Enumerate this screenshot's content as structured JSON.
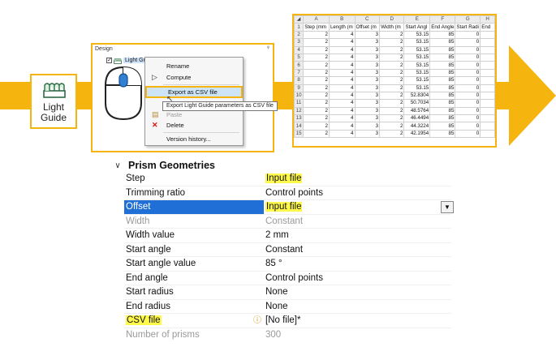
{
  "flow": {
    "accent": "#f6b40e"
  },
  "light_guide_tile": {
    "icon": "light-guide-icon",
    "label_line1": "Light",
    "label_line2": "Guide"
  },
  "design_panel": {
    "title": "Design",
    "tree_item": "Light Guide 1",
    "context_menu": [
      {
        "label": "Rename",
        "icon": ""
      },
      {
        "label": "Compute",
        "icon": "play-icon"
      },
      {
        "label": "Export as CSV file",
        "icon": ""
      },
      {
        "label": "Paste",
        "icon": "paste-icon"
      },
      {
        "label": "Delete",
        "icon": "delete-icon"
      },
      {
        "label": "Version history...",
        "icon": ""
      }
    ],
    "tooltip": "Export Light Guide parameters as CSV file"
  },
  "spreadsheet": {
    "columns": [
      "A",
      "B",
      "C",
      "D",
      "E",
      "F",
      "G",
      "H"
    ],
    "header_row": [
      "Step (mm",
      "Length (m",
      "Offset (m",
      "Width (m",
      "Start Angl",
      "End Angle",
      "Start Radi",
      "End"
    ],
    "rows": [
      [
        "2",
        "4",
        "3",
        "2",
        "53.15",
        "85",
        "0"
      ],
      [
        "2",
        "4",
        "3",
        "2",
        "53.15",
        "85",
        "0"
      ],
      [
        "2",
        "4",
        "3",
        "2",
        "53.15",
        "85",
        "0"
      ],
      [
        "2",
        "4",
        "3",
        "2",
        "53.15",
        "85",
        "0"
      ],
      [
        "2",
        "4",
        "3",
        "2",
        "53.15",
        "85",
        "0"
      ],
      [
        "2",
        "4",
        "3",
        "2",
        "53.15",
        "85",
        "0"
      ],
      [
        "2",
        "4",
        "3",
        "2",
        "53.15",
        "85",
        "0"
      ],
      [
        "2",
        "4",
        "3",
        "2",
        "53.15",
        "85",
        "0"
      ],
      [
        "2",
        "4",
        "3",
        "2",
        "52.8304",
        "85",
        "0"
      ],
      [
        "2",
        "4",
        "3",
        "2",
        "50.7034",
        "85",
        "0"
      ],
      [
        "2",
        "4",
        "3",
        "2",
        "48.5764",
        "85",
        "0"
      ],
      [
        "2",
        "4",
        "3",
        "2",
        "46.4494",
        "85",
        "0"
      ],
      [
        "2",
        "4",
        "3",
        "2",
        "44.3224",
        "85",
        "0"
      ],
      [
        "2",
        "4",
        "3",
        "2",
        "42.1954",
        "85",
        "0"
      ]
    ]
  },
  "properties": {
    "section_title": "Prism Geometries",
    "rows": [
      {
        "name": "Step",
        "value": "Input file",
        "highlight": true
      },
      {
        "name": "Trimming ratio",
        "value": "Control points"
      },
      {
        "name": "Offset",
        "value": "Input file",
        "highlight": true,
        "selected": true
      },
      {
        "name": "Width",
        "value": "Constant",
        "disabled": true
      },
      {
        "name": "Width value",
        "value": "2 mm"
      },
      {
        "name": "Start angle",
        "value": "Constant"
      },
      {
        "name": "Start angle value",
        "value": "85 °"
      },
      {
        "name": "End angle",
        "value": "Control points"
      },
      {
        "name": "Start radius",
        "value": "None"
      },
      {
        "name": "End radius",
        "value": "None"
      },
      {
        "name": "CSV file",
        "value": "[No file]*",
        "name_highlight": true,
        "warning": true
      },
      {
        "name": "Number of prisms",
        "value": "300",
        "disabled": true
      }
    ]
  }
}
